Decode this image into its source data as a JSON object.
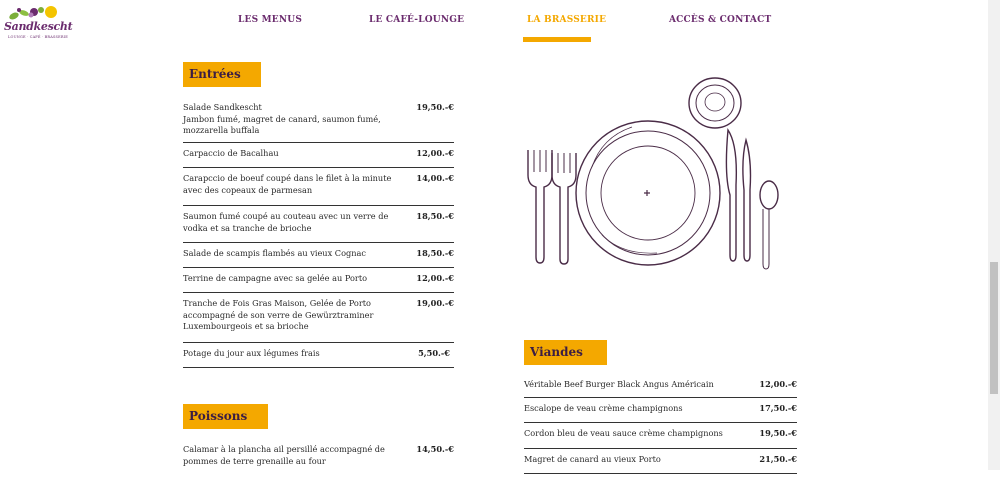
{
  "brand": {
    "name": "Sandkescht",
    "tagline": "LOUNGE · CAFÉ · BRASSERIE",
    "colors": {
      "accent": "#f4a800",
      "brand": "#6b2c6e"
    }
  },
  "nav": {
    "items": [
      {
        "label": "LES MENUS",
        "active": false
      },
      {
        "label": "LE CAFÉ-LOUNGE",
        "active": false
      },
      {
        "label": "LA BRASSERIE",
        "active": true
      },
      {
        "label": "ACCÈS & CONTACT",
        "active": false
      }
    ]
  },
  "entrees": {
    "title": "Entrées",
    "items": [
      {
        "name": "Salade Sandkescht\nJambon fumé, magret de canard, saumon fumé, mozzarella buffala",
        "price": "19,50.-€"
      },
      {
        "name": "Carpaccio de Bacalhau",
        "price": "12,00.-€"
      },
      {
        "name": "Carapccio de boeuf coupé dans le filet à la minute avec des copeaux de parmesan",
        "price": "14,00.-€"
      },
      {
        "name": "Saumon fumé coupé au couteau avec un verre de vodka et sa tranche de brioche",
        "price": "18,50.-€"
      },
      {
        "name": "Salade de scampis flambés au vieux Cognac",
        "price": "18,50.-€"
      },
      {
        "name": "Terrine de campagne avec sa gelée au Porto",
        "price": "12,00.-€"
      },
      {
        "name": "Tranche de Fois Gras Maison, Gelée de Porto accompagné de son verre de Gewürztraminer Luxembourgeois et sa brioche",
        "price": "19,00.-€"
      },
      {
        "name": "Potage du jour aux légumes frais",
        "price": "5,50.-€"
      }
    ]
  },
  "poissons": {
    "title": "Poissons",
    "items": [
      {
        "name": "Calamar à la plancha ail persillé accompagné de pommes de terre grenaille au four",
        "price": "14,50.-€"
      }
    ]
  },
  "viandes": {
    "title": "Viandes",
    "items": [
      {
        "name": "Véritable Beef Burger Black Angus Américain",
        "price": "12,00.-€"
      },
      {
        "name": "Escalope de veau crème champignons",
        "price": "17,50.-€"
      },
      {
        "name": "Cordon bleu de veau sauce crème champignons",
        "price": "19,50.-€"
      },
      {
        "name": "Magret de canard au vieux Porto",
        "price": "21,50.-€"
      }
    ]
  }
}
